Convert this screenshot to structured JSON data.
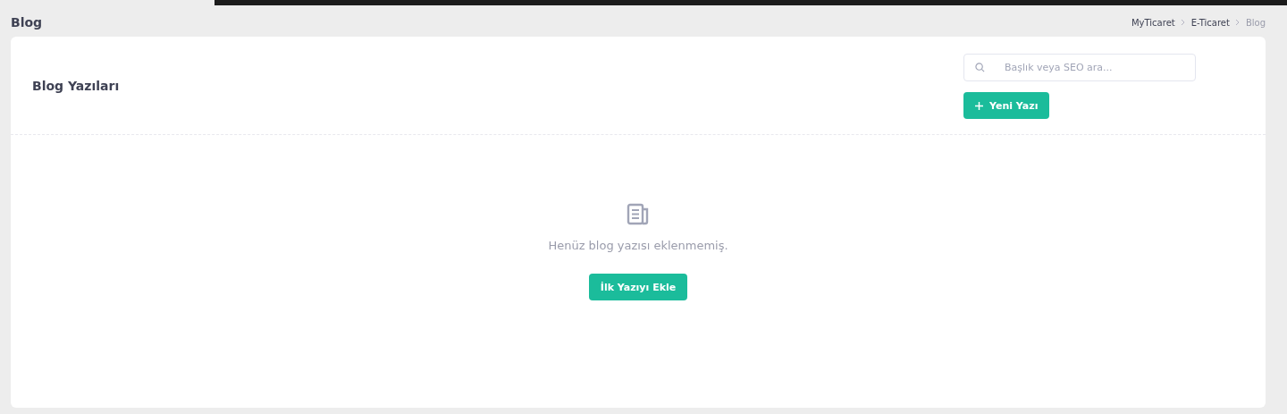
{
  "page_title": "Blog",
  "breadcrumb": [
    {
      "label": "MyTicaret",
      "current": false
    },
    {
      "label": "E-Ticaret",
      "current": false
    },
    {
      "label": "Blog",
      "current": true
    }
  ],
  "card": {
    "title": "Blog Yazıları",
    "search": {
      "placeholder": "Başlık veya SEO ara..."
    },
    "new_button": "Yeni Yazı"
  },
  "empty_state": {
    "message": "Henüz blog yazısı eklenmemiş.",
    "button": "İlk Yazıyı Ekle"
  }
}
